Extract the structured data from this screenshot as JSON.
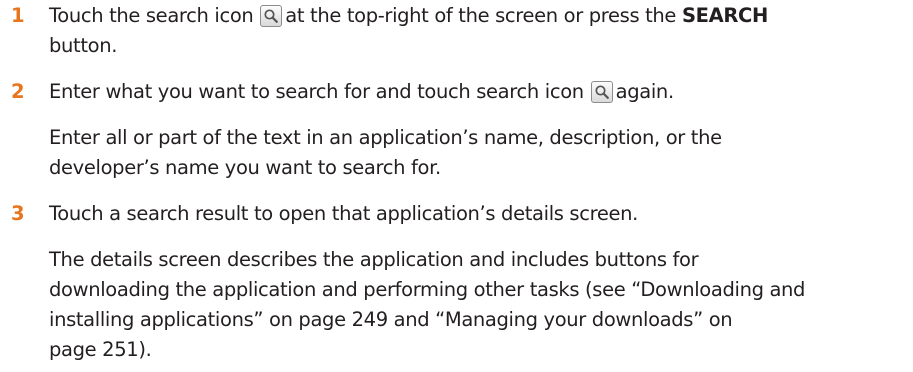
{
  "colors": {
    "step_number": "#e8741e",
    "text": "#231f20",
    "icon_border": "#8c8c8c"
  },
  "steps": [
    {
      "number": "1",
      "line1_a": "Touch the search icon",
      "icon": "search-icon",
      "line1_b": "at the top-right of the screen or press the",
      "line1_bold": "SEARCH",
      "line2": "button."
    },
    {
      "number": "2",
      "line1_a": "Enter what you want to search for and touch search icon",
      "icon": "search-icon",
      "line1_b": "again.",
      "para_line1": "Enter all or part of the text in an application’s name, description, or the",
      "para_line2": "developer’s name you want to search for."
    },
    {
      "number": "3",
      "line1": "Touch a search result to open that application’s details screen.",
      "para_line1": "The details screen describes the application and includes buttons for",
      "para_line2": "downloading the application and performing other tasks (see “Downloading and",
      "para_line3": "installing applications” on page 249 and “Managing your downloads” on",
      "para_line4": "page 251)."
    }
  ]
}
